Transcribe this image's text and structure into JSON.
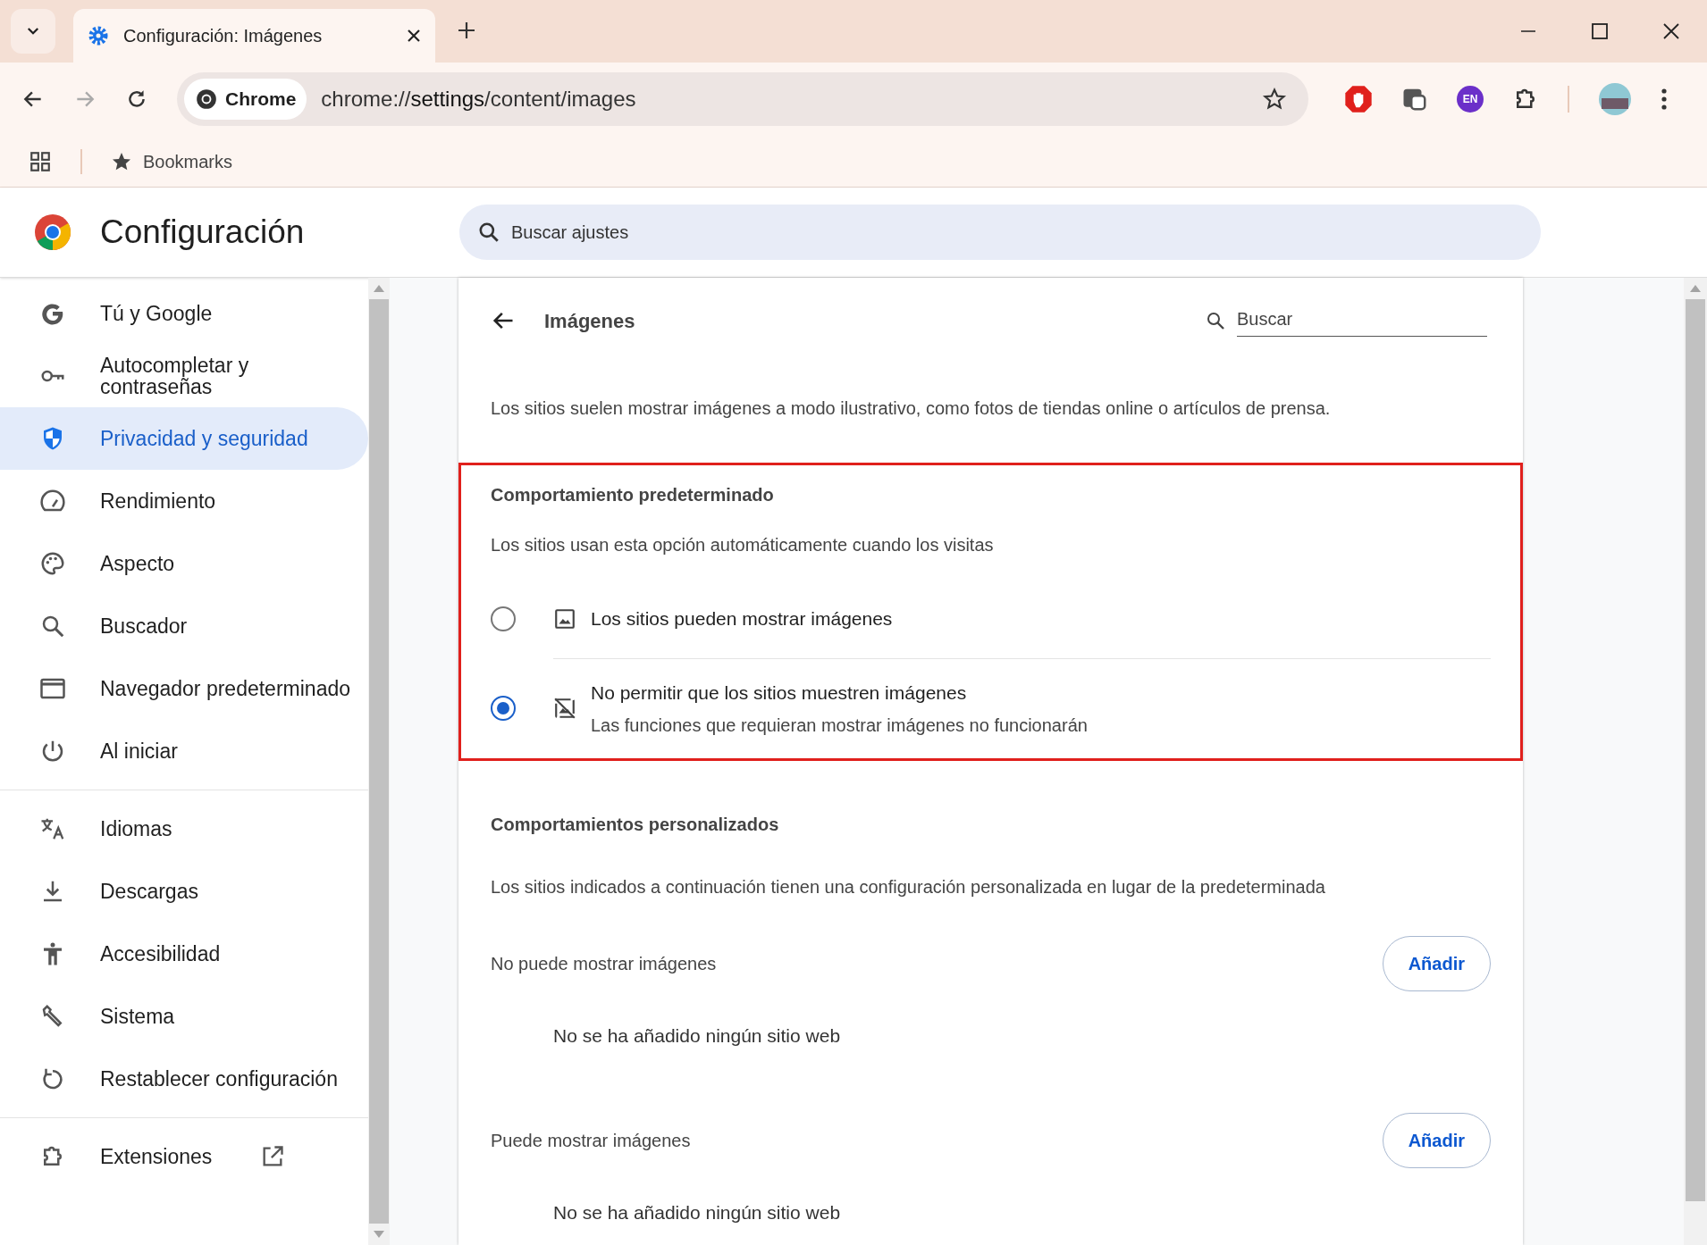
{
  "browser": {
    "tab": {
      "title": "Configuración: Imágenes",
      "selected": true
    },
    "omnibox": {
      "chip": "Chrome",
      "url_host": "chrome://",
      "url_bold": "settings",
      "url_rest": "/content/images"
    },
    "extension_badge": "EN",
    "bookmarks": "Bookmarks"
  },
  "header": {
    "title": "Configuración",
    "search": {
      "placeholder": "Buscar ajustes"
    }
  },
  "sidebar": {
    "groups": [
      [
        {
          "label": "Tú y Google",
          "selected": false
        },
        {
          "label": "Autocompletar y contraseñas",
          "selected": false
        },
        {
          "label": "Privacidad y seguridad",
          "selected": true
        },
        {
          "label": "Rendimiento",
          "selected": false
        },
        {
          "label": "Aspecto",
          "selected": false
        },
        {
          "label": "Buscador",
          "selected": false
        },
        {
          "label": "Navegador predeterminado",
          "selected": false
        },
        {
          "label": "Al iniciar",
          "selected": false
        }
      ],
      [
        {
          "label": "Idiomas",
          "selected": false
        },
        {
          "label": "Descargas",
          "selected": false
        },
        {
          "label": "Accesibilidad",
          "selected": false
        },
        {
          "label": "Sistema",
          "selected": false
        },
        {
          "label": "Restablecer configuración",
          "selected": false
        }
      ],
      [
        {
          "label": "Extensiones",
          "selected": false
        }
      ]
    ]
  },
  "page": {
    "title": "Imágenes",
    "search": {
      "placeholder": "Buscar"
    },
    "description": "Los sitios suelen mostrar imágenes a modo ilustrativo, como fotos de tiendas online o artículos de prensa.",
    "default_behavior": {
      "title": "Comportamiento predeterminado",
      "subtitle": "Los sitios usan esta opción automáticamente cuando los visitas",
      "options": [
        {
          "label": "Los sitios pueden mostrar imágenes",
          "selected": false
        },
        {
          "label": "No permitir que los sitios muestren imágenes",
          "sublabel": "Las funciones que requieran mostrar imágenes no funcionarán",
          "selected": true
        }
      ]
    },
    "custom_behaviors": {
      "title": "Comportamientos personalizados",
      "subtitle": "Los sitios indicados a continuación tienen una configuración personalizada en lugar de la predeterminada",
      "lists": [
        {
          "title": "No puede mostrar imágenes",
          "button": "Añadir",
          "empty": "No se ha añadido ningún sitio web"
        },
        {
          "title": "Puede mostrar imágenes",
          "button": "Añadir",
          "empty": "No se ha añadido ningún sitio web"
        }
      ]
    }
  }
}
